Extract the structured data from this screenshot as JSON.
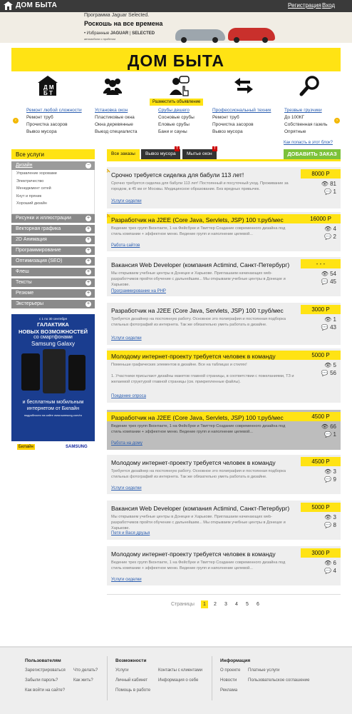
{
  "topbar": {
    "logo": "ДОМ БЫТА",
    "register": "Регистрация",
    "login": "Вход"
  },
  "banner": {
    "line1": "Программа Jaguar Selected.",
    "line2": "Роскошь на все времена",
    "brand_note": "• Избранные",
    "brand_a": "JAGUAR",
    "brand_b": "SELECTED",
    "sub": "автомобили с пробегом"
  },
  "header": {
    "logo": "ДОМ БЫТА"
  },
  "icons": [
    "home-logo-icon",
    "users-icon",
    "person-speech-icon",
    "arrows-swap-icon",
    "search-icon"
  ],
  "icon_tooltip": "Разместить объявление",
  "categories": [
    {
      "title": "Ремонт любой сложности",
      "items": [
        "Ремонт труб",
        "Прочистка засоров",
        "Вывоз мусора"
      ]
    },
    {
      "title": "Установка окон",
      "items": [
        "Пластиковые окна",
        "Окна деревянные",
        "Выезд специалиста"
      ]
    },
    {
      "title": "Срубы дешего",
      "items": [
        "Сосновые срубы",
        "Еловые срубы",
        "Бани и сауны"
      ]
    },
    {
      "title": "Профессиональный техник",
      "items": [
        "Ремонт труб",
        "Прочистка засоров",
        "Вывоз мусора"
      ]
    },
    {
      "title": "Трезвые грузчики",
      "items": [
        "До 100КГ",
        "Собственная газель",
        "Опрятные"
      ]
    }
  ],
  "sidebar": {
    "head": "Все услуги",
    "active": "Дизайн",
    "sub_items": [
      "Управление хоровами",
      "Электричество",
      "Менеджмент сетей",
      "Кнут и пряник",
      "Хороший дизайн"
    ],
    "items": [
      "Рисунки и иллюстрации",
      "Векторная графика",
      "2D Анимация",
      "Программирование",
      "Оптимизация (SEO)",
      "Флеш",
      "Тексты",
      "Резюме",
      "Экстерьеры"
    ]
  },
  "ad": {
    "l1": "с 1 по 30 сентября",
    "l2": "ГАЛАКТИКА",
    "l3": "НОВЫХ ВОЗМОЖНОСТЕЙ",
    "l4": "со смартфонами",
    "l5": "Samsung Galaxy",
    "l6": "и бесплатным мобильным интернетом от Билайн",
    "l7": "подробности на сайте www.samsung.com/ru",
    "logo1": "Билайн",
    "logo2": "SAMSUNG"
  },
  "tabs": [
    {
      "label": "Все заказы"
    },
    {
      "label": "Вывоз мусора"
    },
    {
      "label": "Мытье окон"
    }
  ],
  "how_link": "Как попасть в этот блок?",
  "add_button": "ДОБАВИТЬ ЗАКАЗ",
  "jobs": [
    {
      "title": "Срочно требуется сиделка для бабули 113 лет!",
      "price": "8000 Р",
      "desc": "Срочно требуется сиделка для бабули 113 лет! Постоянный и посуточный уход. Проживание за городом, в 45 км от Москвы. Медицинское образование. Без вредных привычек.",
      "link": "Услуги сиделки",
      "views": "81",
      "replies": "1"
    },
    {
      "title": "Разработчик на J2EE (Core Java, Servlets, JSP) 100 т.руб/мес",
      "price": "16000 Р",
      "desc": "Ведение трех групп Вконтакте, 1 на Фейсбуке и Твиттер Создание современного дизайна под стиль компании + эффектное меню. Ведение групп и наполнение целевой...",
      "link": "Работа сайтов",
      "views": "4",
      "replies": "2"
    },
    {
      "title": "Вакансия Web Developer (компания Actimind, Санкт-Петербург)",
      "price": "- - -",
      "desc": "Мы открываем учебные центры в Донецке и Харькове. Приглашаем начинающих web-разработчиков пройти обучение с дальнейшим... Мы открываем учебные центры в Донецке и Харькове.",
      "link": "Программирование на PHP",
      "views": "54",
      "replies": "45"
    },
    {
      "title": "Разработчик на J2EE (Core Java, Servlets, JSP) 100 т.руб/мес",
      "price": "3000 Р",
      "desc": "Требуется дизайнер на постоянную работу. Основное это полиграфия и постоянная подборка стильных фотографий из интернета. Так же обязательно уметь работать в дизайне.",
      "link": "Услуги сиделки",
      "views": "1",
      "replies": "43"
    },
    {
      "title": "Молодому интернет-проекту требуется человек в команду",
      "price": "5000 Р",
      "desc": "Поменьше графических элементов в дизайне. Все на таблицах и стилях!\n\n1. Участники присылают дизайны макетов главной страницы, в соответствии с пожеланиями, ТЗ и желаемой структурой главной страницы (см. прикрепленные файлы).",
      "link": "Поедение опроса",
      "views": "5",
      "replies": "56"
    },
    {
      "title": "Разработчик на J2EE (Core Java, Servlets, JSP) 100 т.руб/мес",
      "price": "4500 Р",
      "desc": "Ведение трех групп Вконтакте, 1 на Фейсбуке и Твиттер Создание современного дизайна под стиль компании + эффектное меню. Ведение групп и наполнение целевой...",
      "link": "Работа на дому",
      "views": "66",
      "replies": "1"
    },
    {
      "title": "Молодому интернет-проекту требуется человек в команду",
      "price": "4500 Р",
      "desc": "Требуется дизайнер на постоянную работу. Основное это полиграфия и постоянная подборка стильных фотографий из интернета. Так же обязательно уметь работать в дизайне.",
      "link": "Услуги сиделки",
      "views": "3",
      "replies": "9"
    },
    {
      "title": "Вакансия Web Developer (компания Actimind, Санкт-Петербург)",
      "price": "5000 Р",
      "desc": "Мы открываем учебные центры в Донецке и Харькове. Приглашаем начинающих web-разработчиков пройти обучение с дальнейшим... Мы открываем учебные центры в Донецке и Харькове.",
      "link": "Петя и Вася друзья",
      "views": "3",
      "replies": "8"
    },
    {
      "title": "Молодому интернет-проекту требуется человек в команду",
      "price": "3000 Р",
      "desc": "Ведение трех групп Вконтакте, 1 на Фейсбуке и Твиттер Создание современного дизайна под стиль компании + эффектное меню. Ведение групп и наполнение целевой...",
      "link": "Услуги сиделки",
      "views": "6",
      "replies": "4"
    }
  ],
  "pagination": {
    "label": "Страницы",
    "pages": [
      "1",
      "2",
      "3",
      "4",
      "5",
      "6"
    ],
    "current": "1"
  },
  "footer": {
    "users": {
      "title": "Пользователям",
      "links": [
        "Зарегистрироваться",
        "Что делать?",
        "Забыли пароль?",
        "Как жить?",
        "Как войти на сайте?"
      ]
    },
    "features": {
      "title": "Возможности",
      "links": [
        "Услуги",
        "Контакты с клиентами",
        "Личный кабинет",
        "Информация о себе",
        "Помощь в работе"
      ]
    },
    "info": {
      "title": "Информация",
      "links": [
        "О проекте",
        "Платные услуги",
        "Новости",
        "Пользовательское соглашение",
        "Реклама"
      ]
    }
  }
}
